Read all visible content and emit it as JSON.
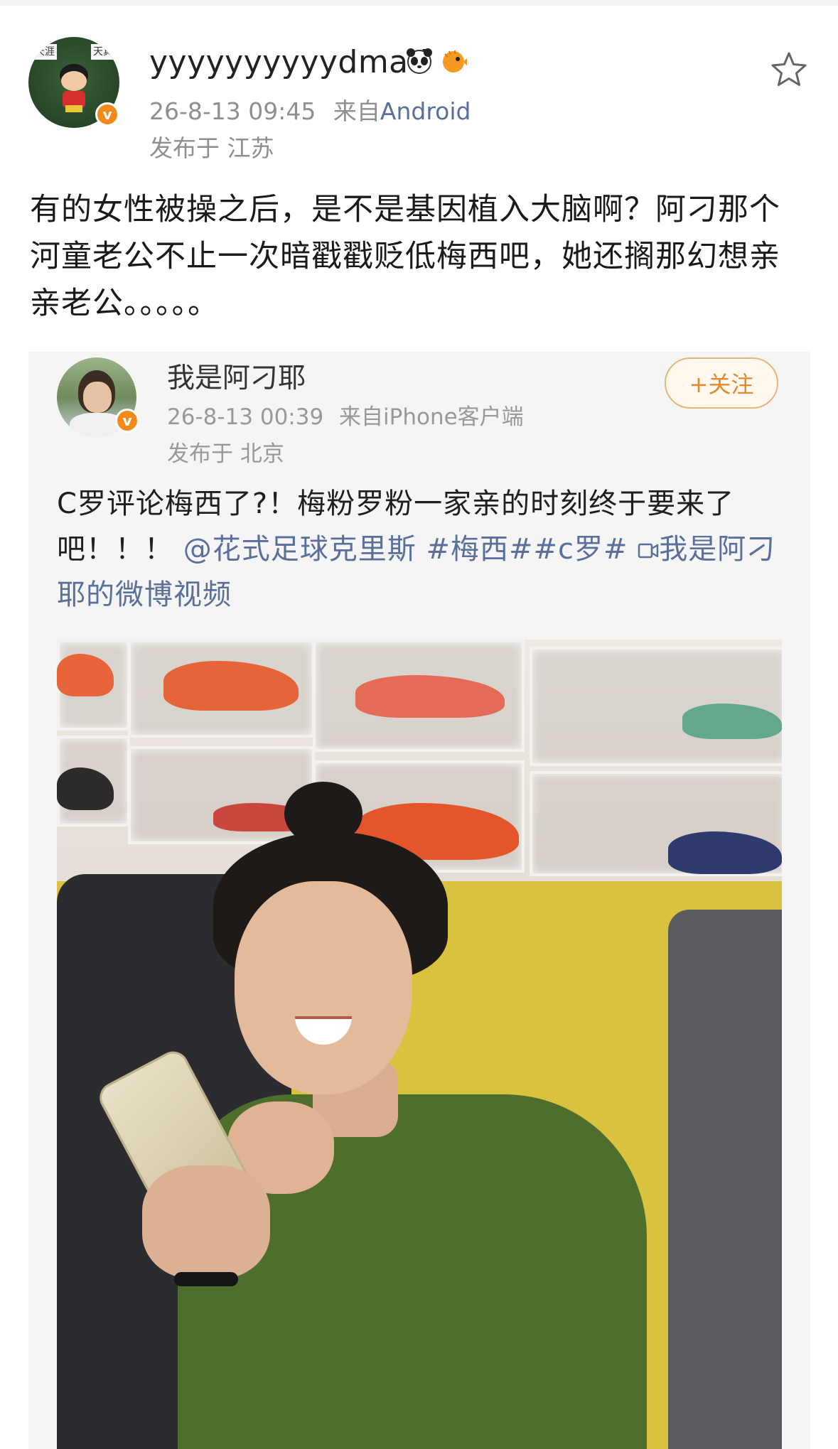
{
  "post": {
    "username": "yyyyyyyyyydmad",
    "emoji_names": [
      "panda-emoji",
      "blowfish-emoji"
    ],
    "time": "26-8-13 09:45",
    "source_prefix": "来自",
    "source_app": "Android",
    "location": "发布于 江苏",
    "verified_badge": "v",
    "text": "有的女性被操之后，是不是基因植入大脑啊？阿刁那个河童老公不止一次暗戳戳贬低梅西吧，她还搁那幻想亲亲老公。。。。。"
  },
  "quoted": {
    "username": "我是阿刁耶",
    "time": "26-8-13 00:39",
    "source_prefix": "来自",
    "source_app": "iPhone客户端",
    "location": "发布于 北京",
    "follow_label": "+关注",
    "text_plain": "C罗评论梅西了?！梅粉罗粉一家亲的时刻终于要来了吧！！！",
    "mention": "@花式足球克里斯",
    "hashtags": "#梅西##c罗#",
    "video_link": "我是阿刁耶的微博视频",
    "verified_badge": "v"
  },
  "colors": {
    "link": "#5a6f99",
    "follow": "#e08a2c",
    "badge": "#f28a1b"
  }
}
